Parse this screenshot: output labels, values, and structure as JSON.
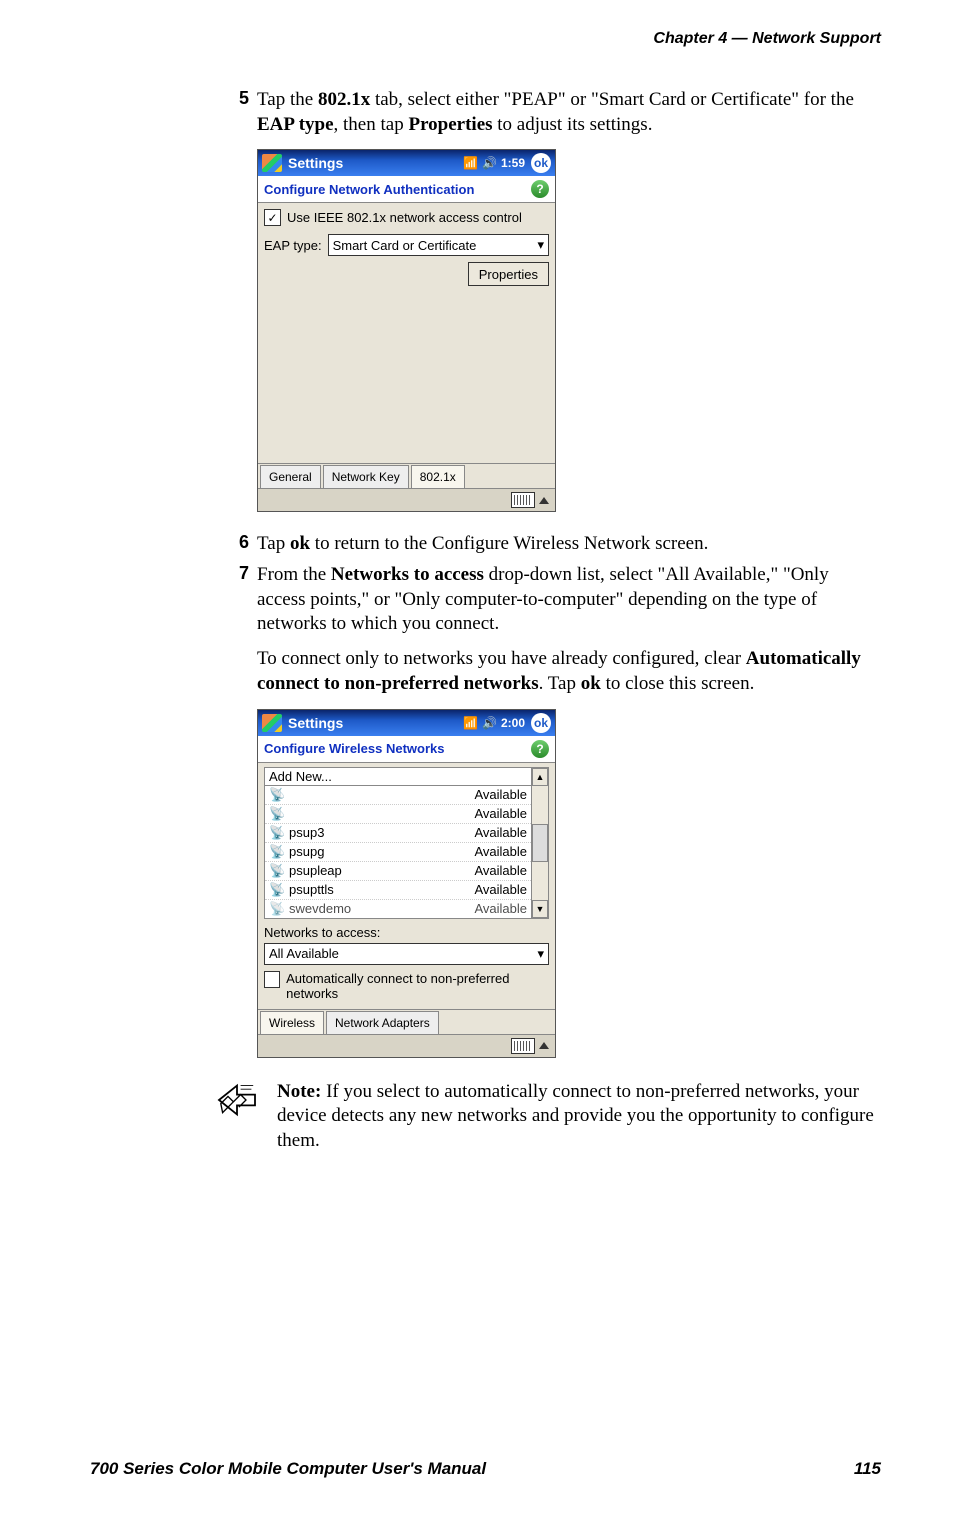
{
  "header": {
    "chapter_ref": "Chapter  4  —  Network Support"
  },
  "steps": {
    "s5": {
      "num": "5",
      "text_pre": "Tap the ",
      "bold1": "802.1x",
      "text_mid1": " tab, select either \"PEAP\" or \"Smart Card or Certificate\" for the ",
      "bold2": "EAP type",
      "text_mid2": ", then tap ",
      "bold3": "Properties",
      "text_post": " to adjust its settings."
    },
    "s6": {
      "num": "6",
      "text_pre": "Tap ",
      "bold1": "ok",
      "text_post": " to return to the Configure Wireless Network screen."
    },
    "s7": {
      "num": "7",
      "line1_pre": "From the ",
      "line1_bold": "Networks to access",
      "line1_post": " drop-down list, select \"All Available,\" \"Only access points,\" or \"Only computer-to-computer\" depending on the type of networks to which you connect.",
      "line2_pre": "To connect only to networks you have already configured, clear ",
      "line2_bold": "Automatically connect to non-preferred networks",
      "line2_mid": ". Tap ",
      "line2_bold2": "ok",
      "line2_post": " to close this screen."
    }
  },
  "screenshot1": {
    "title": "Settings",
    "time": "1:59",
    "ok": "ok",
    "subtitle": "Configure Network Authentication",
    "checkbox_label": "Use IEEE 802.1x network access control",
    "eap_label": "EAP type:",
    "eap_value": "Smart Card or Certificate",
    "properties_btn": "Properties",
    "tabs": [
      "General",
      "Network Key",
      "802.1x"
    ]
  },
  "screenshot2": {
    "title": "Settings",
    "time": "2:00",
    "ok": "ok",
    "subtitle": "Configure Wireless Networks",
    "add_new": "Add New...",
    "networks": [
      {
        "name": "",
        "status": "Available"
      },
      {
        "name": "",
        "status": "Available"
      },
      {
        "name": "psup3",
        "status": "Available"
      },
      {
        "name": "psupg",
        "status": "Available"
      },
      {
        "name": "psupleap",
        "status": "Available"
      },
      {
        "name": "psupttls",
        "status": "Available"
      },
      {
        "name": "swevdemo",
        "status": "Available"
      }
    ],
    "na_label": "Networks to access:",
    "na_value": "All Available",
    "auto_label": "Automatically connect to non-preferred networks",
    "tabs": [
      "Wireless",
      "Network Adapters"
    ]
  },
  "note": {
    "bold": "Note:",
    "text": " If you select to automatically connect to non-preferred networks, your device detects any new networks and provide you the opportunity to configure them."
  },
  "footer": {
    "left": "700 Series Color Mobile Computer User's Manual",
    "page": "115"
  }
}
